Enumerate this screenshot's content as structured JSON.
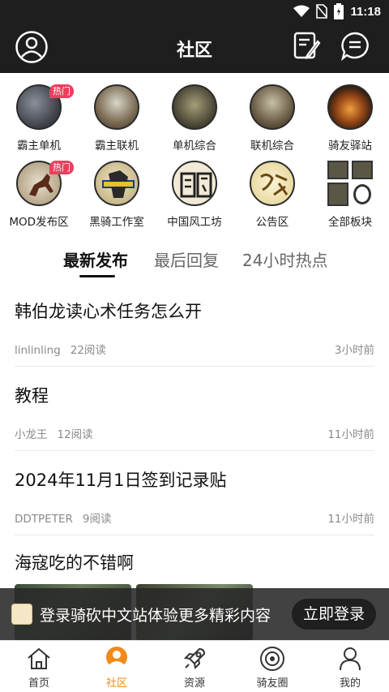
{
  "status": {
    "time": "11:18"
  },
  "appbar": {
    "title": "社区"
  },
  "categories": [
    {
      "label": "霸主单机",
      "hot": "热门"
    },
    {
      "label": "霸主联机"
    },
    {
      "label": "单机综合"
    },
    {
      "label": "联机综合"
    },
    {
      "label": "骑友驿站"
    },
    {
      "label": "MOD发布区",
      "hot": "热门"
    },
    {
      "label": "黑骑工作室"
    },
    {
      "label": "中国风工坊"
    },
    {
      "label": "公告区"
    },
    {
      "label": "全部板块"
    }
  ],
  "tabs": [
    "最新发布",
    "最后回复",
    "24小时热点"
  ],
  "posts": [
    {
      "title": "韩伯龙读心术任务怎么开",
      "author": "linlinling",
      "reads": "22阅读",
      "time": "3小时前"
    },
    {
      "title": "教程",
      "author": "小龙王",
      "reads": "12阅读",
      "time": "11小时前"
    },
    {
      "title": "2024年11月1日签到记录贴",
      "author": "DDTPETER",
      "reads": "9阅读",
      "time": "11小时前"
    },
    {
      "title": "海寇吃的不错啊"
    }
  ],
  "banner": {
    "text": "登录骑砍中文站体验更多精彩内容",
    "button": "立即登录"
  },
  "bottom_nav": [
    "首页",
    "社区",
    "资源",
    "骑友圈",
    "我的"
  ],
  "colors": {
    "accent": "#f28a1a",
    "hot_badge": "#ee3d5f",
    "appbar": "#1e1e1e"
  }
}
